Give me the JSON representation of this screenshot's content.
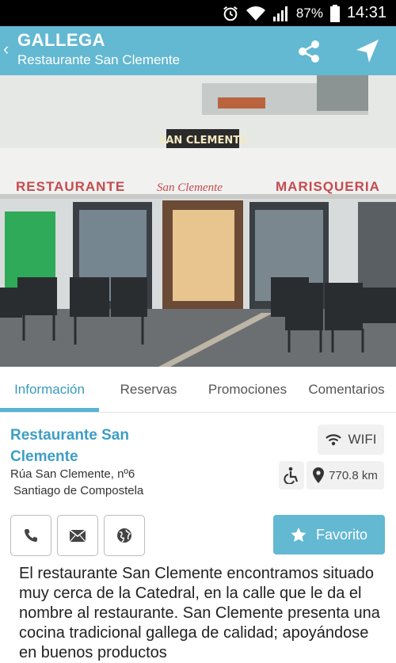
{
  "status_bar": {
    "battery": "87%",
    "time": "14:31"
  },
  "app_bar": {
    "title": "GALLEGA",
    "subtitle": "Restaurante San Clemente"
  },
  "photo": {
    "sign": "SAN CLEMENTE",
    "awning_left": "RESTAURANTE",
    "awning_middle": "San Clemente",
    "awning_right": "MARISQUERIA"
  },
  "tabs": [
    {
      "label": "Información"
    },
    {
      "label": "Reservas"
    },
    {
      "label": "Promociones"
    },
    {
      "label": "Comentarios"
    }
  ],
  "restaurant": {
    "name": "Restaurante San Clemente",
    "address_line1": "Rúa San Clemente, nº6",
    "address_line2": "Santiago de Compostela"
  },
  "amenities": {
    "wifi_label": "WIFI",
    "distance": "770.8 km"
  },
  "actions": {
    "favorite_label": "Favorito"
  },
  "description": "El restaurante San Clemente encontramos situado muy cerca de la Catedral, en la calle que le da el nombre al restaurante. San Clemente presenta una cocina tradicional gallega de calidad; apoyándose en buenos productos",
  "colors": {
    "accent": "#63b8d2",
    "title_text": "#3d9ec5",
    "status_bar": "#000000"
  }
}
